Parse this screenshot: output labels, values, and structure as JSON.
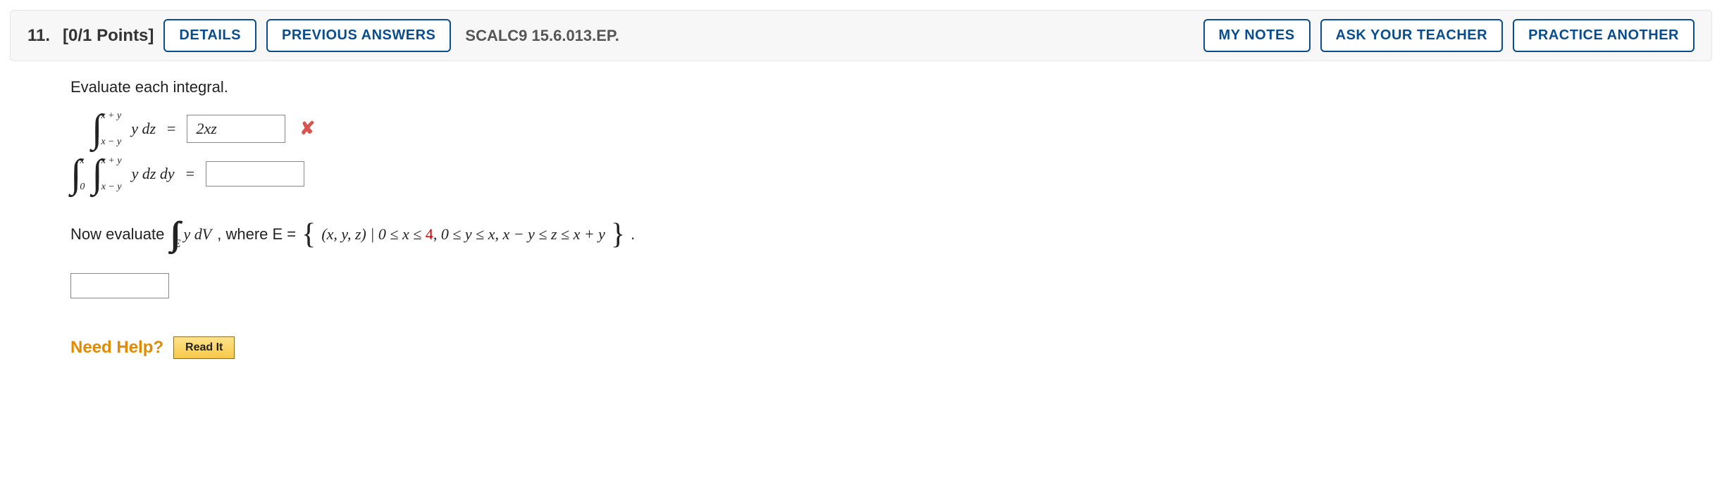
{
  "header": {
    "number": "11.",
    "points": "[0/1 Points]",
    "details_label": "DETAILS",
    "previous_label": "PREVIOUS ANSWERS",
    "source": "SCALC9 15.6.013.EP.",
    "mynotes_label": "MY NOTES",
    "ask_label": "ASK YOUR TEACHER",
    "practice_label": "PRACTICE ANOTHER"
  },
  "body": {
    "prompt": "Evaluate each integral.",
    "int1": {
      "upper": "x + y",
      "lower": "x − y",
      "integrand": "y dz",
      "eq": "=",
      "answer": "2xz"
    },
    "int2": {
      "outer_upper": "x",
      "outer_lower": "0",
      "inner_upper": "x + y",
      "inner_lower": "x − y",
      "integrand": "y dz dy",
      "eq": "=",
      "answer": ""
    },
    "now_evaluate": {
      "lead": "Now evaluate",
      "expr": "y dV",
      "where": ", where E =",
      "set_text_1": "(x, y, z) | 0 ≤ x ≤ ",
      "set_red": "4",
      "set_text_2": ", 0 ≤ y ≤ x, x − y ≤ z ≤ x + y",
      "period": "."
    },
    "help": {
      "label": "Need Help?",
      "read": "Read It"
    }
  }
}
